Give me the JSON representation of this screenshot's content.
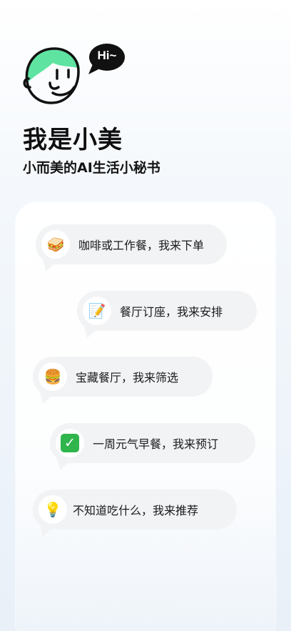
{
  "header": {
    "avatar_icon": "smiling-face-avatar-icon",
    "greeting": "Hi~",
    "title": "我是小美",
    "subtitle": "小而美的AI生活小秘书"
  },
  "suggestions": [
    {
      "icon": "sandwich-icon",
      "emoji": "🥪",
      "label": "咖啡或工作餐，我来下单"
    },
    {
      "icon": "memo-icon",
      "emoji": "📝",
      "label": "餐厅订座，我来安排"
    },
    {
      "icon": "burger-icon",
      "emoji": "🍔",
      "label": "宝藏餐厅，我来筛选"
    },
    {
      "icon": "check-icon",
      "emoji": "✓",
      "label": "一周元气早餐，我来预订"
    },
    {
      "icon": "lightbulb-icon",
      "emoji": "💡",
      "label": "不知道吃什么，我来推荐"
    }
  ],
  "colors": {
    "avatar_green": "#5fe3a1",
    "bubble_bg": "#f2f3f5",
    "check_green": "#2fb54b"
  }
}
